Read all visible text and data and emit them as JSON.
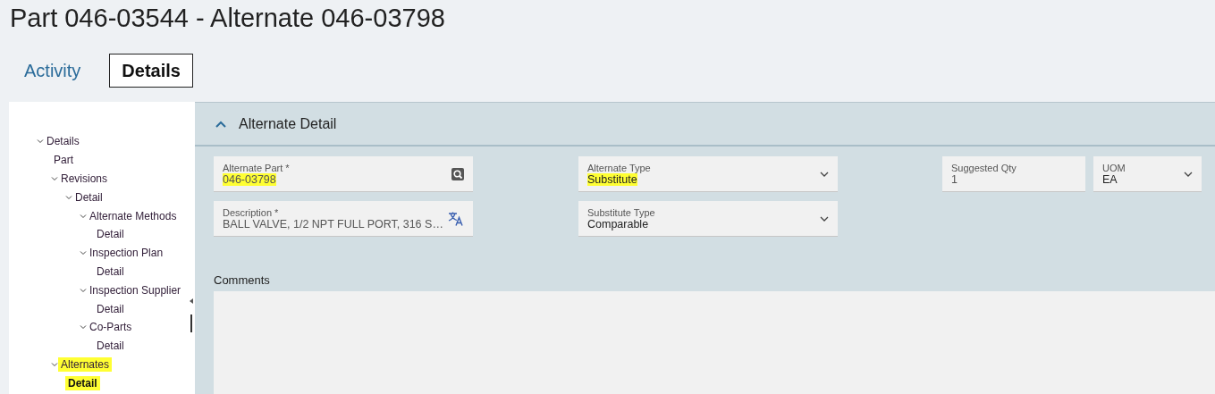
{
  "page_title": "Part 046-03544 - Alternate 046-03798",
  "tabs": [
    {
      "label": "Activity",
      "selected": false
    },
    {
      "label": "Details",
      "selected": true
    }
  ],
  "tree": [
    {
      "label": "Details",
      "expanded": true,
      "selected": false,
      "highlighted": false,
      "children": [
        {
          "label": "Part",
          "selected": false,
          "highlighted": false
        },
        {
          "label": "Revisions",
          "expanded": true,
          "selected": false,
          "highlighted": false,
          "children": [
            {
              "label": "Detail",
              "expanded": true,
              "selected": false,
              "highlighted": false,
              "children": [
                {
                  "label": "Alternate Methods",
                  "expanded": true,
                  "selected": false,
                  "highlighted": false,
                  "children": [
                    {
                      "label": "Detail",
                      "selected": false,
                      "highlighted": false
                    }
                  ]
                },
                {
                  "label": "Inspection Plan",
                  "expanded": true,
                  "selected": false,
                  "highlighted": false,
                  "children": [
                    {
                      "label": "Detail",
                      "selected": false,
                      "highlighted": false
                    }
                  ]
                },
                {
                  "label": "Inspection Supplier",
                  "expanded": true,
                  "selected": false,
                  "highlighted": false,
                  "children": [
                    {
                      "label": "Detail",
                      "selected": false,
                      "highlighted": false
                    }
                  ]
                },
                {
                  "label": "Co-Parts",
                  "expanded": true,
                  "selected": false,
                  "highlighted": false,
                  "children": [
                    {
                      "label": "Detail",
                      "selected": false,
                      "highlighted": false
                    }
                  ]
                }
              ]
            }
          ]
        },
        {
          "label": "Alternates",
          "expanded": true,
          "selected": false,
          "highlighted": true,
          "children": [
            {
              "label": "Detail",
              "selected": true,
              "highlighted": true
            }
          ]
        }
      ]
    }
  ],
  "section": {
    "title": "Alternate Detail",
    "expanded": true
  },
  "fields": [
    {
      "label": "Alternate Part *",
      "value": "046-03798",
      "kind": "lookup",
      "highlighted": true
    },
    {
      "label": "Alternate Type",
      "value": "Substitute",
      "kind": "dropdown",
      "highlighted": true
    },
    {
      "label": "Suggested Qty",
      "value": "1",
      "kind": "text",
      "highlighted": false
    },
    {
      "label": "UOM",
      "value": "EA",
      "kind": "dropdown",
      "highlighted": false
    },
    {
      "label": "Description *",
      "value": "BALL VALVE, 1/2 NPT FULL PORT, 316 S…",
      "kind": "translate",
      "highlighted": false
    },
    {
      "label": "Substitute Type",
      "value": "Comparable",
      "kind": "dropdown",
      "highlighted": false
    }
  ],
  "comments": {
    "label": "Comments"
  }
}
